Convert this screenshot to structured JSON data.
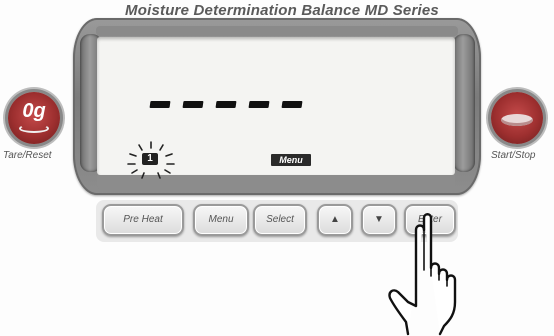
{
  "header": {
    "title": "Moisture Determination Balance  MD Series"
  },
  "display": {
    "reading": "- - - - -",
    "step_indicator": "1",
    "menu_indicator": "Menu"
  },
  "side_buttons": {
    "tare": {
      "face": "0g",
      "label": "Tare/Reset",
      "icon": "tare-dish-icon"
    },
    "start": {
      "label": "Start/Stop",
      "icon": "start-dish-icon"
    }
  },
  "keys": {
    "preheat": "Pre Heat",
    "menu": "Menu",
    "select": "Select",
    "up": "▲",
    "down": "▼",
    "enter": "Enter"
  },
  "colors": {
    "button_red": "#9d2f2f",
    "frame_gray": "#7b7b7b",
    "lcd_bg": "#f4f4f2"
  }
}
